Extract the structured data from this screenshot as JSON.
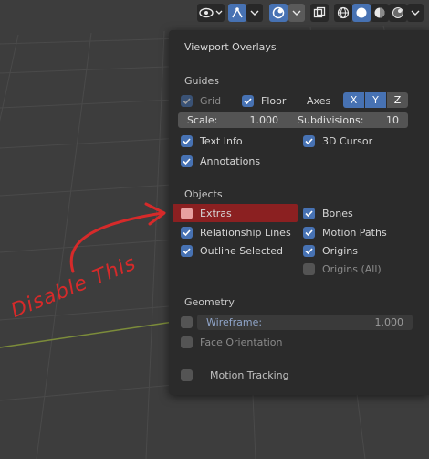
{
  "panel": {
    "title": "Viewport Overlays",
    "guides": {
      "heading": "Guides",
      "grid": {
        "label": "Grid",
        "checked": true
      },
      "floor": {
        "label": "Floor",
        "checked": true
      },
      "axes_label": "Axes",
      "axes": [
        "X",
        "Y",
        "Z"
      ],
      "scale": {
        "label": "Scale:",
        "value": "1.000"
      },
      "subdivisions": {
        "label": "Subdivisions:",
        "value": "10"
      },
      "text_info": {
        "label": "Text Info",
        "checked": true
      },
      "cursor_3d": {
        "label": "3D Cursor",
        "checked": true
      },
      "annotations": {
        "label": "Annotations",
        "checked": true
      }
    },
    "objects": {
      "heading": "Objects",
      "extras": {
        "label": "Extras",
        "checked": false
      },
      "bones": {
        "label": "Bones",
        "checked": true
      },
      "relationship_lines": {
        "label": "Relationship Lines",
        "checked": true
      },
      "motion_paths": {
        "label": "Motion Paths",
        "checked": true
      },
      "outline_selected": {
        "label": "Outline Selected",
        "checked": true
      },
      "origins": {
        "label": "Origins",
        "checked": true
      },
      "origins_all": {
        "label": "Origins (All)",
        "checked": false
      }
    },
    "geometry": {
      "heading": "Geometry",
      "wireframe": {
        "label": "Wireframe:",
        "value": "1.000",
        "checked": false
      },
      "face_orientation": {
        "label": "Face Orientation",
        "checked": false
      }
    },
    "motion_tracking": {
      "label": "Motion Tracking",
      "checked": false
    }
  },
  "annotation_text": "Disable This",
  "colors": {
    "accent": "#4772b3",
    "highlight": "#8b2021",
    "annotation": "#d62a2a",
    "panel_bg": "#2b2b2b"
  }
}
